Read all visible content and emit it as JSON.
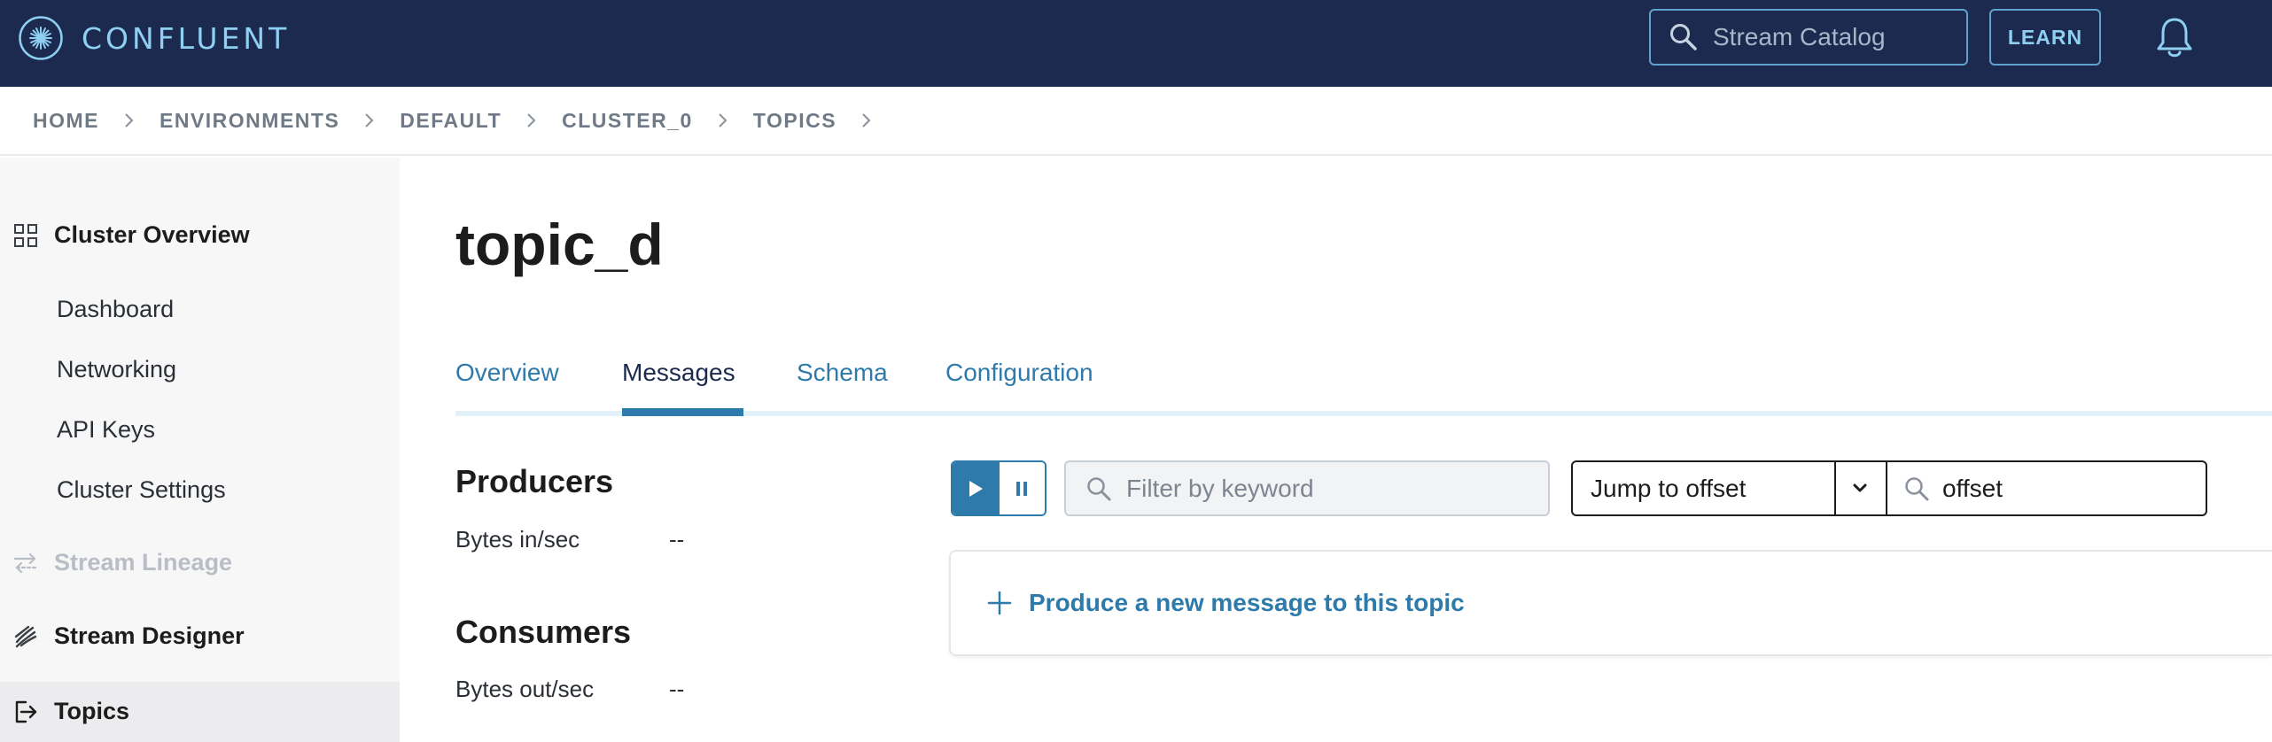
{
  "topbar": {
    "brand": "CONFLUENT",
    "search_placeholder": "Stream Catalog",
    "learn_label": "LEARN"
  },
  "breadcrumb": [
    "HOME",
    "ENVIRONMENTS",
    "DEFAULT",
    "CLUSTER_0",
    "TOPICS"
  ],
  "sidebar": {
    "cluster_overview": "Cluster Overview",
    "sub_items": [
      "Dashboard",
      "Networking",
      "API Keys",
      "Cluster Settings"
    ],
    "stream_lineage": "Stream Lineage",
    "stream_designer": "Stream Designer",
    "topics": "Topics"
  },
  "main": {
    "title": "topic_d",
    "tabs": [
      {
        "label": "Overview",
        "active": false
      },
      {
        "label": "Messages",
        "active": true
      },
      {
        "label": "Schema",
        "active": false
      },
      {
        "label": "Configuration",
        "active": false
      }
    ],
    "producers": {
      "title": "Producers",
      "label": "Bytes in/sec",
      "value": "--"
    },
    "consumers": {
      "title": "Consumers",
      "label": "Bytes out/sec",
      "value": "--"
    },
    "filter_placeholder": "Filter by keyword",
    "jump_select": "Jump to offset",
    "offset_placeholder": "offset",
    "produce_label": "Produce a new message to this topic"
  },
  "colors": {
    "nav_bg": "#1b2a4e",
    "accent": "#2e7bab",
    "brand_light": "#8fd0f2"
  }
}
